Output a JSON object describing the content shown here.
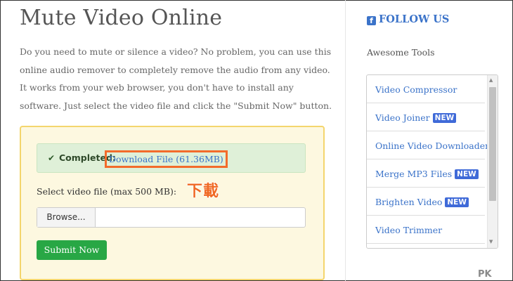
{
  "page": {
    "title": "Mute Video Online",
    "description": "Do you need to mute or silence a video? No problem, you can use this online audio remover to completely remove the audio from any video. It works from your web browser, you don't have to install any software. Just select the video file and click the \"Submit Now\" button."
  },
  "panel": {
    "completed_label": "Completed:",
    "download_link": "Download File (61.36MB)",
    "annotation": "下載",
    "select_label": "Select video file (max 500 MB):",
    "browse_label": "Browse...",
    "file_value": "",
    "submit_label": "Submit Now"
  },
  "sidebar": {
    "follow_label": "FOLLOW US",
    "awesome_label": "Awesome Tools",
    "tools": [
      {
        "label": "Video Compressor",
        "badge": ""
      },
      {
        "label": "Video Joiner",
        "badge": "NEW"
      },
      {
        "label": "Online Video Downloader",
        "badge": ""
      },
      {
        "label": "Merge MP3 Files",
        "badge": "NEW"
      },
      {
        "label": "Brighten Video",
        "badge": "NEW"
      },
      {
        "label": "Video Trimmer",
        "badge": ""
      }
    ]
  },
  "watermark": "PK",
  "colors": {
    "link": "#3b73c9",
    "success_bg": "#dff0d8",
    "submit": "#28a745",
    "annotation": "#f06a24",
    "badge": "#3f6ad8",
    "panel_bg": "#fdf8e0"
  }
}
